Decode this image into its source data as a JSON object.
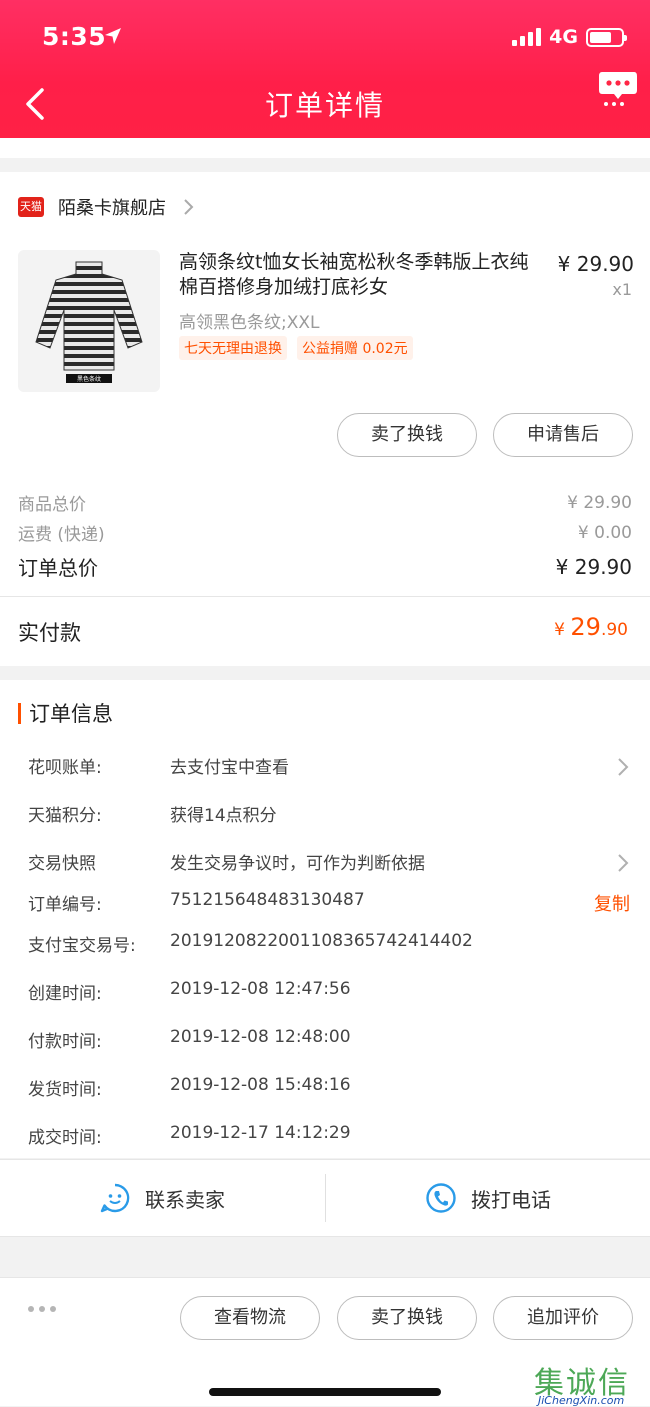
{
  "status_bar": {
    "time": "5:35",
    "network": "4G"
  },
  "header": {
    "title": "订单详情"
  },
  "store": {
    "badge": "天猫",
    "name": "陌桑卡旗舰店"
  },
  "product": {
    "title": "高领条纹t恤女长袖宽松秋冬季韩版上衣纯棉百搭修身加绒打底衫女",
    "price": "¥ 29.90",
    "quantity": "x1",
    "sku": "高领黑色条纹;XXL",
    "tags": [
      "七天无理由退换",
      "公益捐赠 0.02元"
    ],
    "thumb_caption": "黑色条纹"
  },
  "product_actions": {
    "sell": "卖了换钱",
    "after_sale": "申请售后"
  },
  "totals": {
    "goods_label": "商品总价",
    "goods_value": "¥ 29.90",
    "shipping_label": "运费 (快递)",
    "shipping_value": "¥ 0.00",
    "order_label": "订单总价",
    "order_value": "¥ 29.90",
    "paid_label": "实付款",
    "paid_symbol": "¥ ",
    "paid_int": "29",
    "paid_dec": ".90"
  },
  "order_info": {
    "heading": "订单信息",
    "rows": [
      {
        "label": "花呗账单:",
        "value": "去支付宝中查看"
      },
      {
        "label": "天猫积分:",
        "value": "获得14点积分"
      },
      {
        "label": "交易快照",
        "value": "发生交易争议时，可作为判断依据"
      },
      {
        "label": "订单编号:",
        "value": "751215648483130487"
      },
      {
        "label": "支付宝交易号:",
        "value": "2019120822001108365742414402"
      },
      {
        "label": "创建时间:",
        "value": "2019-12-08 12:47:56"
      },
      {
        "label": "付款时间:",
        "value": "2019-12-08 12:48:00"
      },
      {
        "label": "发货时间:",
        "value": "2019-12-08 15:48:16"
      },
      {
        "label": "成交时间:",
        "value": "2019-12-17 14:12:29"
      }
    ],
    "copy_label": "复制"
  },
  "contact": {
    "seller": "联系卖家",
    "phone": "拨打电话"
  },
  "footer": {
    "logistics": "查看物流",
    "sell": "卖了换钱",
    "review": "追加评价"
  },
  "watermark": {
    "main": "集诚信",
    "sub": "JiChengXin.com"
  },
  "colors": {
    "header_red": "#ff2645",
    "accent_orange": "#ff5000",
    "icon_blue": "#2a9be8"
  }
}
